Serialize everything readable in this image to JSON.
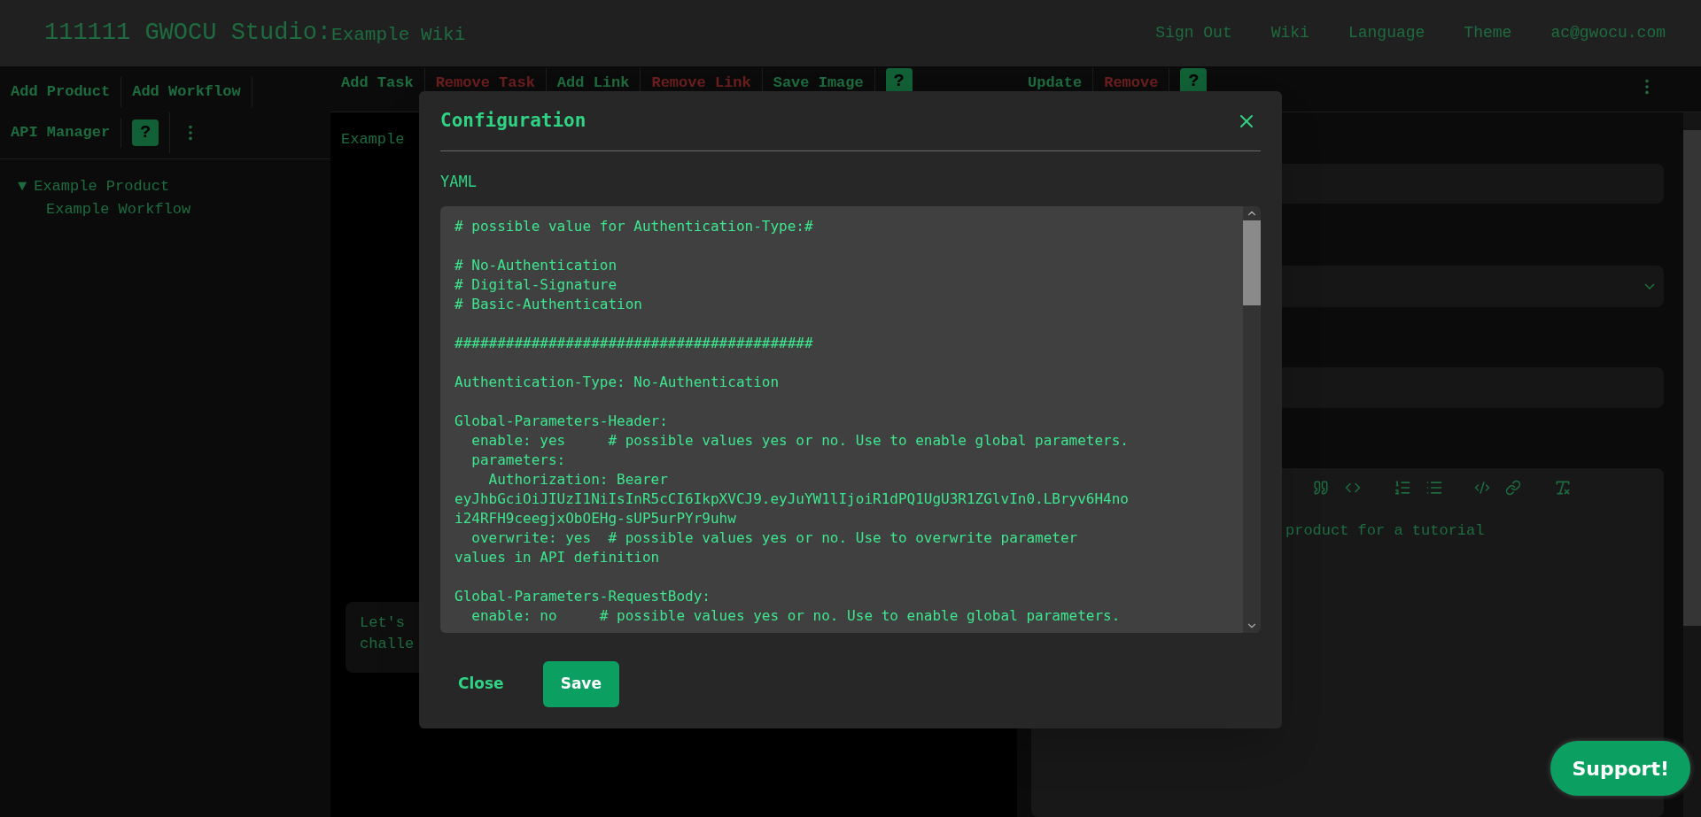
{
  "header": {
    "title": "111111 GWOCU Studio:",
    "subtitle": "Example Wiki",
    "nav": [
      "Sign Out",
      "Wiki",
      "Language",
      "Theme",
      "ac@gwocu.com"
    ]
  },
  "left_panel": {
    "toolbar": [
      {
        "label": "Add Product"
      },
      {
        "label": "Add Workflow"
      },
      {
        "label": "API Manager"
      }
    ],
    "help": "?",
    "tree": [
      {
        "label": "Example Product",
        "toggle": "▼",
        "expanded": true,
        "children": [
          {
            "label": "Example Workflow"
          }
        ]
      }
    ]
  },
  "canvas_panel": {
    "toolbar": [
      {
        "label": "Add Task",
        "kind": "normal"
      },
      {
        "label": "Remove Task",
        "kind": "danger"
      },
      {
        "label": "Add Link",
        "kind": "normal"
      },
      {
        "label": "Remove Link",
        "kind": "danger"
      },
      {
        "label": "Save Image",
        "kind": "normal"
      }
    ],
    "help": "?",
    "heading": "Example",
    "chat_bubble": [
      "Let's",
      "challe"
    ]
  },
  "details_panel": {
    "toolbar": [
      {
        "label": "Update",
        "kind": "normal"
      },
      {
        "label": "Remove",
        "kind": "danger"
      }
    ],
    "help": "?",
    "description_text": "product for a tutorial"
  },
  "dialog": {
    "title": "Configuration",
    "field_label": "YAML",
    "yaml": "# possible value for Authentication-Type:#\n\n# No-Authentication\n# Digital-Signature\n# Basic-Authentication\n\n##########################################\n\nAuthentication-Type: No-Authentication\n\nGlobal-Parameters-Header:\n  enable: yes     # possible values yes or no. Use to enable global parameters.\n  parameters:\n    Authorization: Bearer\neyJhbGciOiJIUzI1NiIsInR5cCI6IkpXVCJ9.eyJuYW1lIjoiR1dPQ1UgU3R1ZGlvIn0.LBryv6H4no\ni24RFH9ceegjxObOEHg-sUP5urPYr9uhw\n  overwrite: yes  # possible values yes or no. Use to overwrite parameter\nvalues in API definition\n\nGlobal-Parameters-RequestBody:\n  enable: no     # possible values yes or no. Use to enable global parameters.",
    "buttons": [
      {
        "label": "Close",
        "kind": "text"
      },
      {
        "label": "Save",
        "kind": "primary"
      }
    ]
  },
  "support_button": "Support!"
}
